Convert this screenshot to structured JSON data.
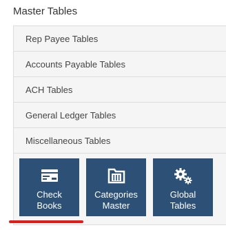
{
  "section": {
    "title": "Master Tables"
  },
  "menu": {
    "items": [
      {
        "label": "Rep Payee Tables"
      },
      {
        "label": "Accounts Payable Tables"
      },
      {
        "label": "ACH Tables"
      },
      {
        "label": "General Ledger Tables"
      },
      {
        "label": "Miscellaneous Tables"
      }
    ]
  },
  "tiles": [
    {
      "line1": "Check",
      "line2": "Books",
      "icon": "checkbook-icon",
      "active": true
    },
    {
      "line1": "Categories",
      "line2": "Master",
      "icon": "folder-icon",
      "active": false
    },
    {
      "line1": "Global",
      "line2": "Tables",
      "icon": "gears-icon",
      "active": false
    }
  ],
  "colors": {
    "tile_bg": "#2c5076",
    "active_indicator": "#e21b1b",
    "panel_bg": "#f5f5f5"
  }
}
